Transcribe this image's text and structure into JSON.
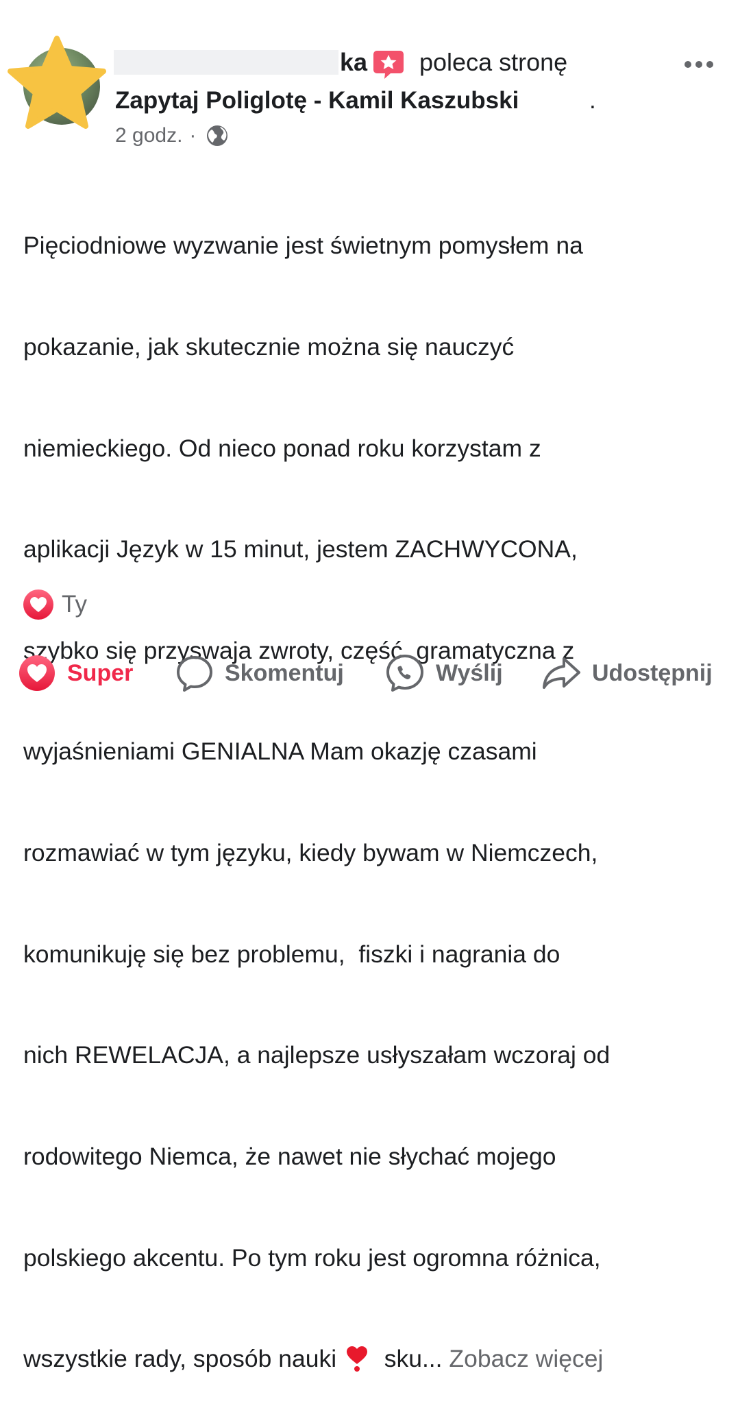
{
  "post": {
    "author_name_visible_tail": "ka",
    "recommends_label": "poleca stronę",
    "page_name": "Zapytaj Poliglotę - Kamil Kaszubski",
    "page_name_suffix": ".",
    "time": "2 godz.",
    "separator": "·",
    "body_lines": [
      "Pięciodniowe wyzwanie jest świetnym pomysłem na",
      "pokazanie, jak skutecznie można się nauczyć",
      "niemieckiego. Od nieco ponad roku korzystam z",
      "aplikacji Język w 15 minut, jestem ZACHWYCONA,",
      "szybko się przyswaja zwroty, część  gramatyczna z",
      "wyjaśnieniami GENIALNA Mam okazję czasami",
      "rozmawiać w tym języku, kiedy bywam w Niemczech,",
      "komunikuję się bez problemu,  fiszki i nagrania do",
      "nich REWELACJA, a najlepsze usłyszałam wczoraj od",
      "rodowitego Niemca, że nawet nie słychać mojego",
      "polskiego akcentu. Po tym roku jest ogromna różnica,"
    ],
    "last_line_before_heart": "wszystkie rady, sposób nauki ",
    "last_line_after_heart": "  sku...",
    "see_more": "Zobacz więcej"
  },
  "reactions": {
    "summary": "Ty",
    "icon": "heart-reaction-icon"
  },
  "actions": {
    "super": "Super",
    "comment": "Skomentuj",
    "send": "Wyślij",
    "share": "Udostępnij"
  },
  "colors": {
    "heart_red": "#f0284a",
    "muted_text": "#65676b",
    "star_yellow": "#f7c342",
    "badge_pink": "#f3516b"
  },
  "icons": [
    "star-icon",
    "recommend-badge-icon",
    "more-options-icon",
    "globe-icon",
    "heart-icon",
    "comment-icon",
    "messenger-icon",
    "share-icon"
  ]
}
